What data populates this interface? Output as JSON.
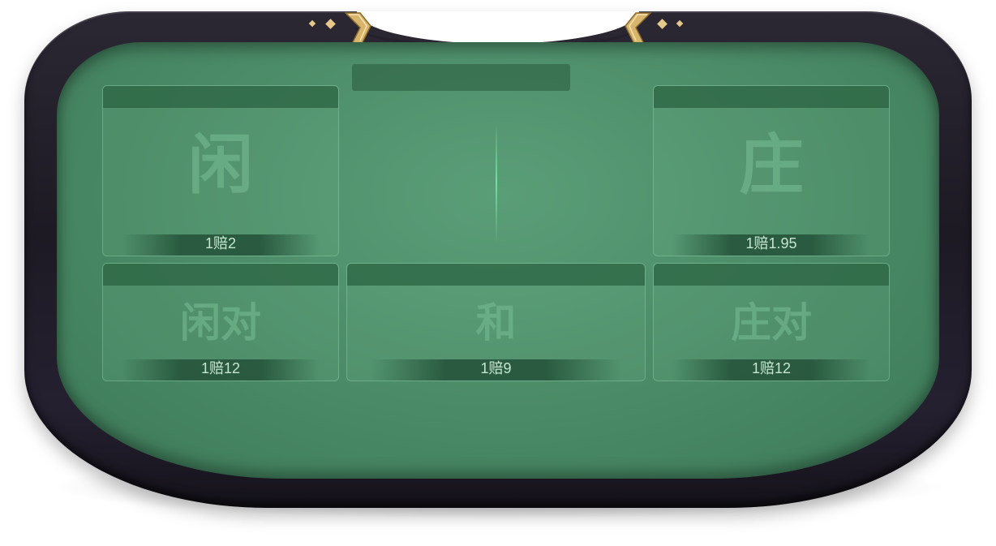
{
  "table": {
    "felt_color": "#4a8a66",
    "rim_color": "#1d1a24",
    "accent_gold": "#e6c98a"
  },
  "zones": {
    "player": {
      "label": "闲",
      "odds": "1赔2"
    },
    "banker": {
      "label": "庄",
      "odds": "1赔1.95"
    },
    "player_pair": {
      "label": "闲对",
      "odds": "1赔12"
    },
    "tie": {
      "label": "和",
      "odds": "1赔9"
    },
    "banker_pair": {
      "label": "庄对",
      "odds": "1赔12"
    }
  }
}
